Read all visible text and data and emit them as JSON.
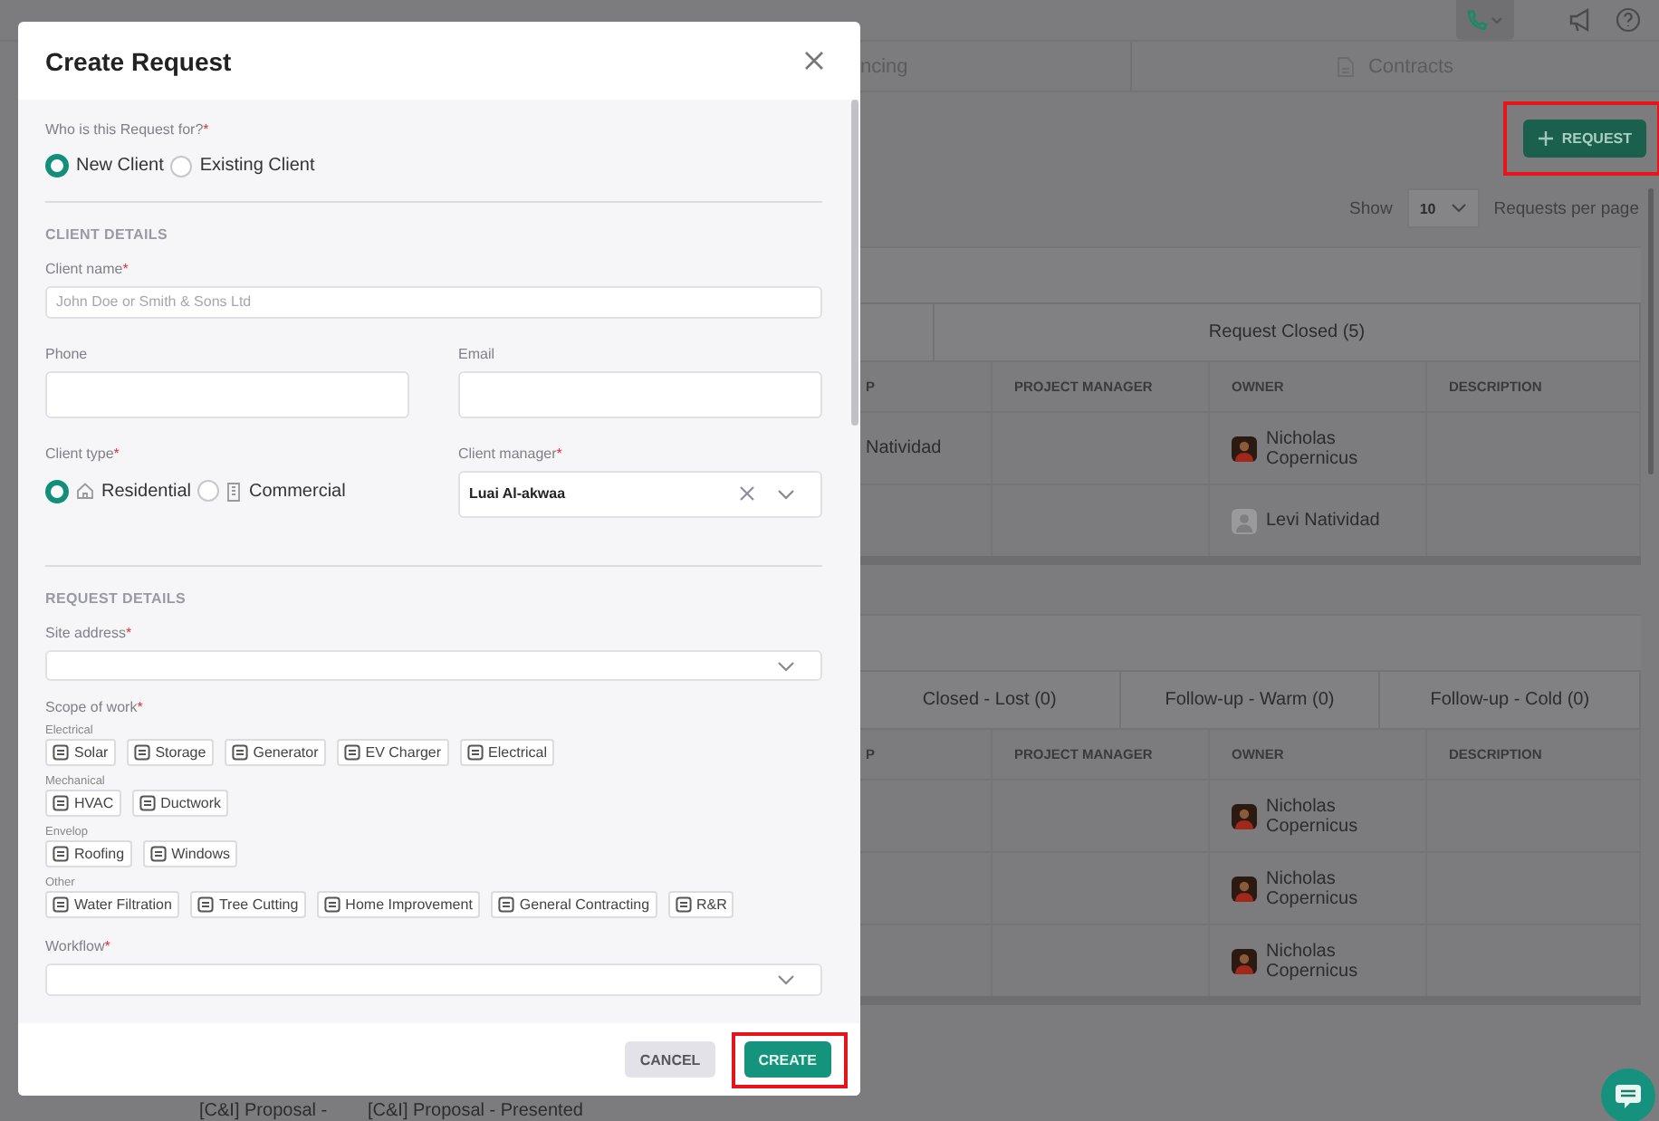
{
  "tabs": [
    {
      "label": "ncing"
    },
    {
      "label": "Contracts"
    }
  ],
  "request_button": {
    "label": "REQUEST",
    "highlighted": true
  },
  "page_size": {
    "label": "Show",
    "value": "10",
    "suffix": "Requests per page"
  },
  "sections": [
    {
      "stages": [
        "Request Closed (5)"
      ],
      "columns": [
        "P",
        "PROJECT MANAGER",
        "OWNER",
        "DESCRIPTION"
      ],
      "rows": [
        {
          "column_1": "Natividad",
          "owner": {
            "name": "Nicholas Copernicus",
            "kind": "photo"
          }
        },
        {
          "owner": {
            "name": "Levi Natividad",
            "kind": "placeholder"
          }
        }
      ]
    },
    {
      "stages": [
        "Closed - Lost (0)",
        "Follow-up - Warm (0)",
        "Follow-up - Cold (0)"
      ],
      "columns": [
        "P",
        "PROJECT MANAGER",
        "OWNER",
        "DESCRIPTION"
      ],
      "rows": [
        {
          "owner": {
            "name": "Nicholas Copernicus",
            "kind": "photo"
          }
        },
        {
          "owner": {
            "name": "Nicholas Copernicus",
            "kind": "photo"
          }
        },
        {
          "owner": {
            "name": "Nicholas Copernicus",
            "kind": "photo"
          }
        }
      ]
    }
  ],
  "bottom_row": [
    "[C&I] Proposal -",
    "[C&I] Proposal - Presented"
  ],
  "modal": {
    "title": "Create Request",
    "recipient": {
      "label": "Who is this Request for?",
      "required_mark": "*",
      "options": [
        {
          "label": "New Client",
          "selected": true
        },
        {
          "label": "Existing Client",
          "selected": false
        }
      ]
    },
    "client_details": {
      "heading": "CLIENT DETAILS",
      "client_name": {
        "label": "Client name",
        "required_mark": "*",
        "placeholder": "John Doe or Smith & Sons Ltd"
      },
      "phone": {
        "label": "Phone"
      },
      "email": {
        "label": "Email"
      },
      "client_type": {
        "label": "Client type",
        "required_mark": "*",
        "options": [
          {
            "label": "Residential",
            "selected": true
          },
          {
            "label": "Commercial",
            "selected": false
          }
        ]
      },
      "client_manager": {
        "label": "Client manager",
        "required_mark": "*",
        "value": "Luai Al-akwaa"
      }
    },
    "request_details": {
      "heading": "REQUEST DETAILS",
      "site_address": {
        "label": "Site address",
        "required_mark": "*"
      },
      "scope": {
        "label": "Scope of work",
        "required_mark": "*",
        "groups": [
          {
            "name": "Electrical",
            "items": [
              "Solar",
              "Storage",
              "Generator",
              "EV Charger",
              "Electrical"
            ]
          },
          {
            "name": "Mechanical",
            "items": [
              "HVAC",
              "Ductwork"
            ]
          },
          {
            "name": "Envelop",
            "items": [
              "Roofing",
              "Windows"
            ]
          },
          {
            "name": "Other",
            "items": [
              "Water Filtration",
              "Tree Cutting",
              "Home Improvement",
              "General Contracting",
              "R&R"
            ]
          }
        ]
      },
      "workflow": {
        "label": "Workflow",
        "required_mark": "*"
      }
    },
    "buttons": [
      {
        "label": "CANCEL",
        "kind": "secondary",
        "highlighted": false
      },
      {
        "label": "CREATE",
        "kind": "primary",
        "highlighted": true
      }
    ]
  }
}
